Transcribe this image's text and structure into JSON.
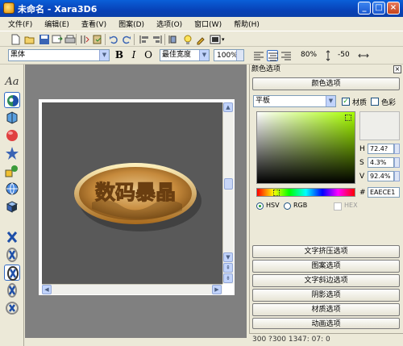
{
  "window": {
    "title": "未命名 - Xara3D6",
    "minimize": "_",
    "maximize": "□",
    "close": "×"
  },
  "menu": [
    "文件(F)",
    "编辑(E)",
    "查看(V)",
    "图案(D)",
    "选项(O)",
    "窗口(W)",
    "帮助(H)"
  ],
  "format_bar": {
    "font": "黑体",
    "bold": "B",
    "italic": "I",
    "outline": "O",
    "width_mode": "最佳宽度",
    "zoom": "100%",
    "line_spacing": "80%",
    "kerning": "-50"
  },
  "canvas": {
    "text_3d": "数码暴晶"
  },
  "panel": {
    "title": "颜色选项",
    "color_header": "颜色选项",
    "shading_select": "平板",
    "material_label": "材质",
    "material_checked": true,
    "color_label": "色彩",
    "color_checked": false,
    "h_label": "H",
    "h_value": "72.4?",
    "s_label": "S",
    "s_value": "4.3%",
    "v_label": "V",
    "v_value": "92.4%",
    "hex_label": "#",
    "hex_value": "EAECE1",
    "mode_hsv": "HSV",
    "mode_rgb": "RGB",
    "mode_hex": "HEX",
    "sections": [
      "文字挤压选项",
      "图案选项",
      "文字斜边选项",
      "阴影选项",
      "材质选项",
      "动画选项"
    ]
  },
  "status": {
    "text": "300 ?300  1347: 07: 0"
  },
  "colors": {
    "titlebar": "#0842b8",
    "workspace": "#808080",
    "canvas": "#595959",
    "swatch": "#EAECE1"
  }
}
